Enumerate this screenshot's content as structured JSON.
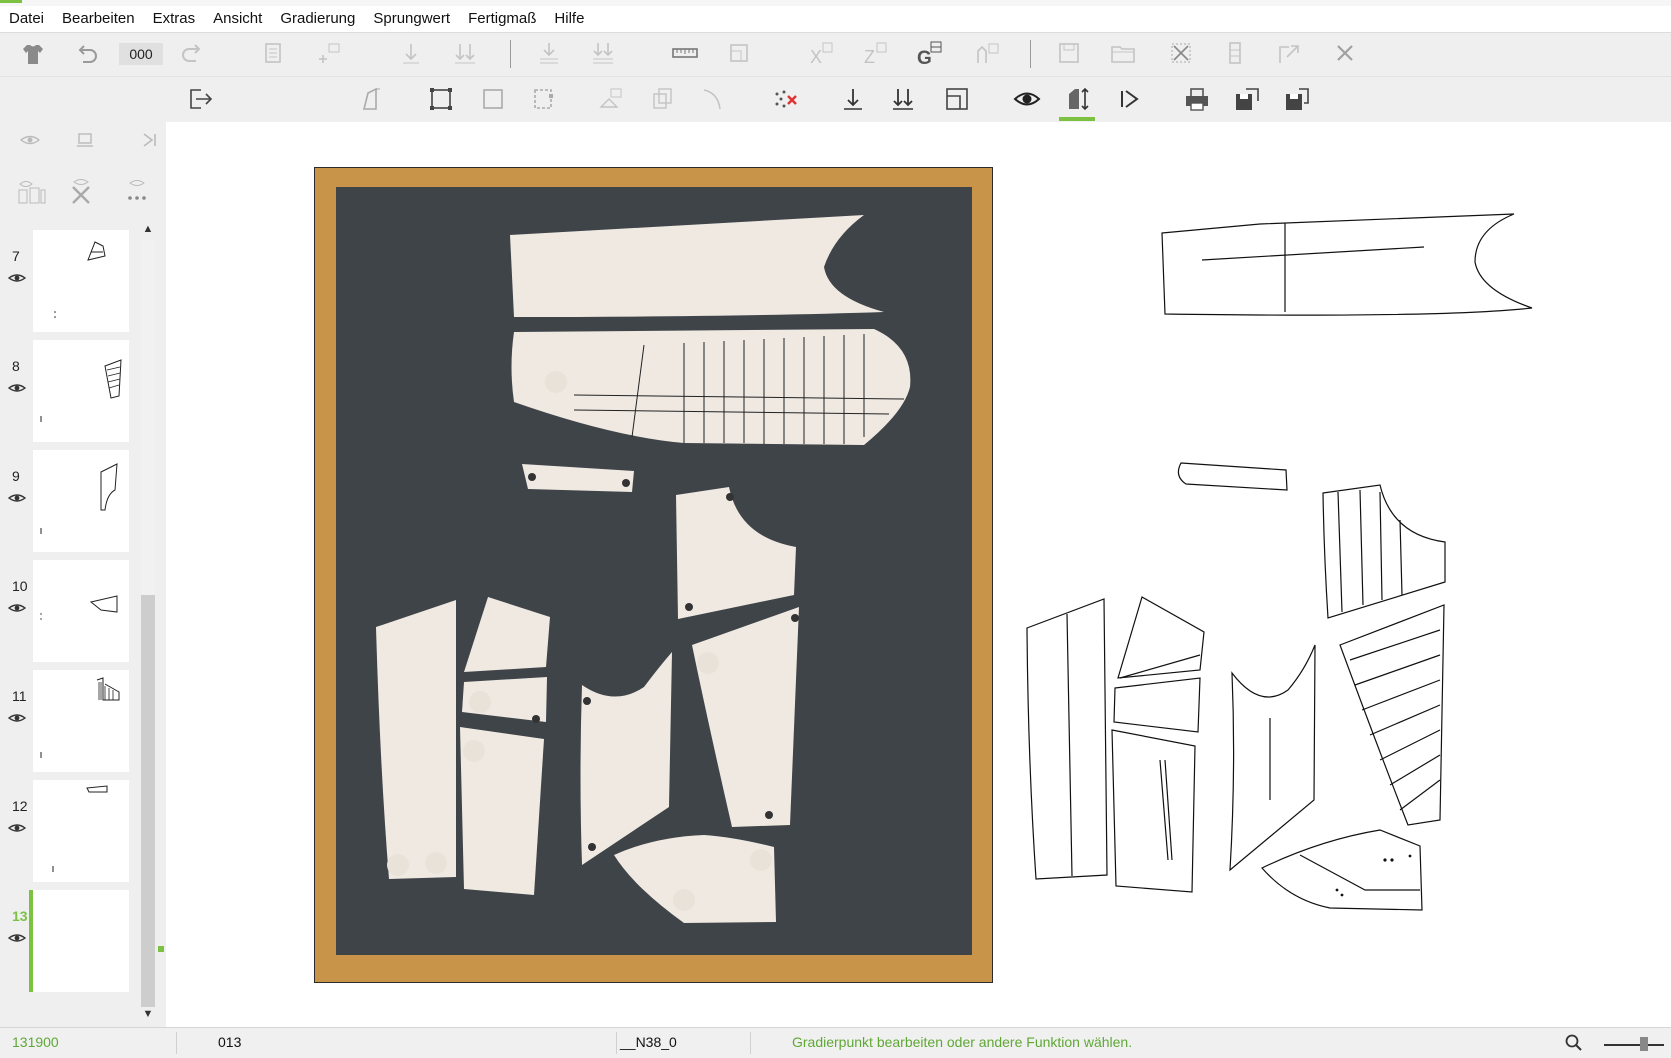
{
  "menu": [
    "Datei",
    "Bearbeiten",
    "Extras",
    "Ansicht",
    "Gradierung",
    "Sprungwert",
    "Fertigmaß",
    "Hilfe"
  ],
  "toolbar": {
    "counter_value": "000"
  },
  "pages": [
    {
      "number": "7",
      "active": false
    },
    {
      "number": "8",
      "active": false
    },
    {
      "number": "9",
      "active": false
    },
    {
      "number": "10",
      "active": false
    },
    {
      "number": "11",
      "active": false
    },
    {
      "number": "12",
      "active": false
    },
    {
      "number": "13",
      "active": true
    }
  ],
  "status": {
    "left_id": "131900",
    "page": "013",
    "size": "__N38_0",
    "message": "Gradierpunkt bearbeiten oder andere Funktion wählen."
  },
  "colors": {
    "accent": "#7cc142",
    "status_text": "#5fa836",
    "board": "#3f4449",
    "wood": "#c8944a",
    "paper": "#efe9e2"
  },
  "icons": {
    "toolbar1": [
      "tshirt-icon",
      "undo-icon",
      "redo-icon",
      "document-icon",
      "add-point-icon",
      "arrow-down-icon",
      "double-arrow-down-icon",
      "align-down-icon",
      "align-double-down-icon",
      "ruler-icon",
      "frame-icon",
      "x-grade-icon",
      "z-grade-icon",
      "g-grade-icon",
      "person-grade-icon",
      "save-icon",
      "open-folder-icon",
      "grid-delete-icon",
      "column-icon",
      "export-icon",
      "close-icon"
    ],
    "toolbar2": [
      "exit-icon",
      "piece-icon",
      "select-rect-icon",
      "rect-icon",
      "rect-side-icon",
      "layer-icon",
      "copy-icon",
      "curve-icon",
      "delete-points-icon",
      "arrow-down-icon",
      "double-arrow-down-icon",
      "frame-corner-icon",
      "eye-icon",
      "grade-icon",
      "play-icon",
      "printer-icon",
      "save-as-icon",
      "save-all-icon"
    ]
  }
}
